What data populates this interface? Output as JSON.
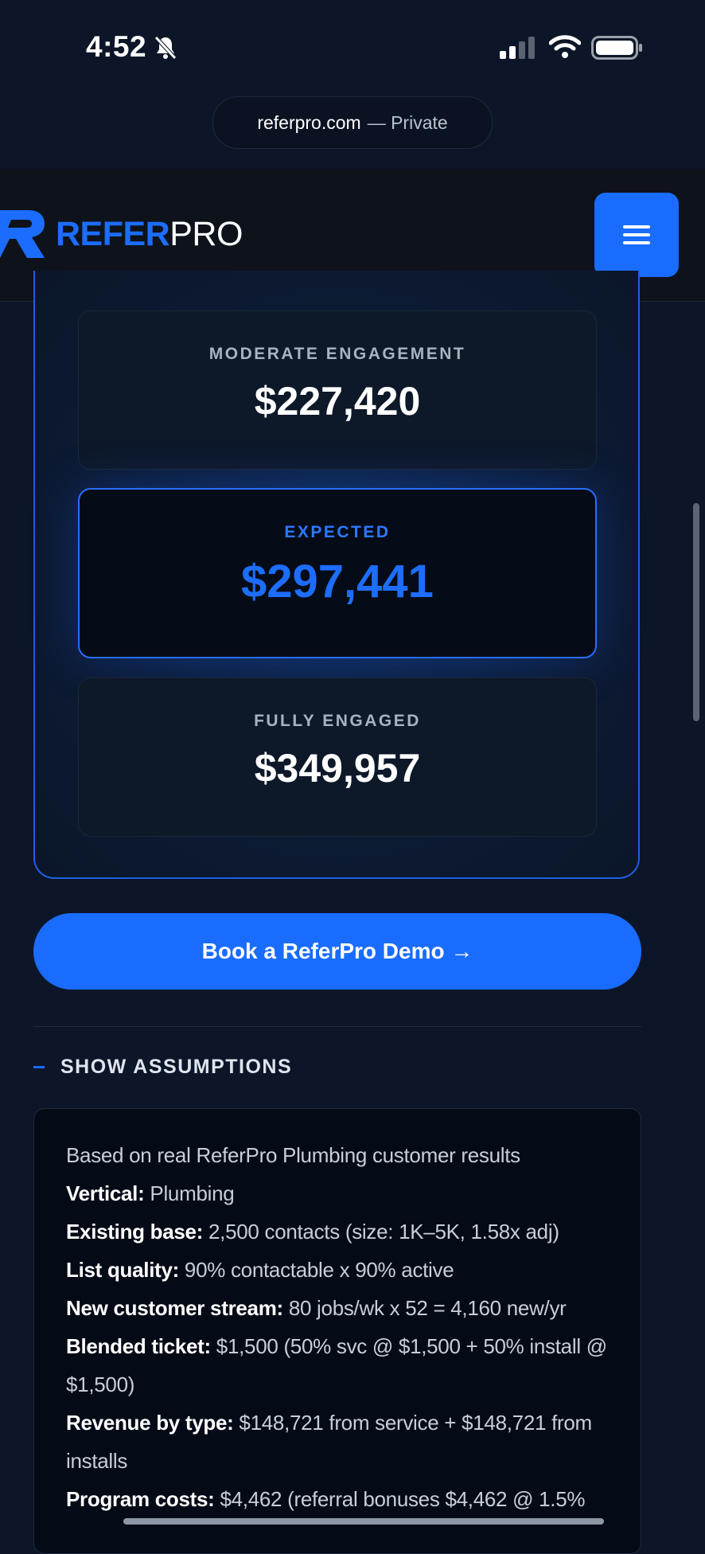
{
  "status_bar": {
    "time": "4:52"
  },
  "browser": {
    "domain": "referpro.com",
    "privacy_label": "— Private"
  },
  "header": {
    "logo_refer": "REFER",
    "logo_pro": "PRO",
    "menu_icon": "hamburger-menu-icon"
  },
  "results": {
    "moderate": {
      "label": "MODERATE ENGAGEMENT",
      "value": "$227,420"
    },
    "expected": {
      "label": "EXPECTED",
      "value": "$297,441"
    },
    "full": {
      "label": "FULLY ENGAGED",
      "value": "$349,957"
    }
  },
  "cta": {
    "label": "Book a ReferPro Demo →"
  },
  "assumptions": {
    "toggle_label": "SHOW ASSUMPTIONS",
    "intro": "Based on real ReferPro Plumbing customer results",
    "lines": [
      {
        "key": "Vertical:",
        "text": " Plumbing"
      },
      {
        "key": "Existing base:",
        "text": " 2,500 contacts (size: 1K–5K, 1.58x adj)"
      },
      {
        "key": "List quality:",
        "text": " 90% contactable x 90% active"
      },
      {
        "key": "New customer stream:",
        "text": " 80 jobs/wk x 52 = 4,160 new/yr"
      },
      {
        "key": "Blended ticket:",
        "text": " $1,500 (50% svc @ $1,500 + 50% install @ $1,500)"
      },
      {
        "key": "Revenue by type:",
        "text": " $148,721 from service + $148,721 from installs"
      },
      {
        "key": "Program costs:",
        "text": " $4,462 (referral bonuses $4,462 @ 1.5%"
      }
    ]
  },
  "colors": {
    "accent": "#1a6cff",
    "background": "#0c1628"
  }
}
